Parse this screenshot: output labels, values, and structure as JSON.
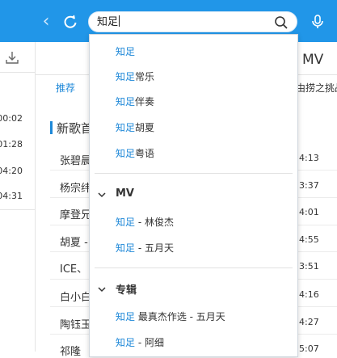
{
  "search": {
    "value": "知足"
  },
  "main": {
    "mv_header": "MV",
    "tab_recommend": "推荐",
    "challenge_text": "由捞之挑战",
    "section_title": "新歌首",
    "songs": [
      {
        "title": "张碧晨",
        "duration": "4:13"
      },
      {
        "title": "杨宗纬",
        "duration": "3:37"
      },
      {
        "title": "摩登兄",
        "duration": "4:01"
      },
      {
        "title": "胡夏 -",
        "duration": "4:55"
      },
      {
        "title": "ICE、",
        "duration": "3:51"
      },
      {
        "title": "白小白",
        "duration": "4:16"
      },
      {
        "title": "陶钰玉",
        "duration": "4:27"
      },
      {
        "title": "祁隆",
        "duration": "5:07"
      }
    ]
  },
  "left": {
    "times": [
      "00:02",
      "01:28",
      "04:20",
      "04:31"
    ]
  },
  "dropdown": {
    "suggestions": [
      {
        "hl": "知足",
        "rest": ""
      },
      {
        "hl": "知足",
        "rest": "常乐"
      },
      {
        "hl": "知足",
        "rest": "伴奏"
      },
      {
        "hl": "知足",
        "rest": "胡夏"
      },
      {
        "hl": "知足",
        "rest": "粤语"
      }
    ],
    "mv_label": "MV",
    "mv_items": [
      {
        "hl": "知足",
        "rest": " - 林俊杰"
      },
      {
        "hl": "知足",
        "rest": " - 五月天"
      }
    ],
    "album_label": "专辑",
    "album_items": [
      {
        "hl": "知足",
        "rest": " 最真杰作选 - 五月天"
      },
      {
        "hl": "知足",
        "rest": " - 阿细"
      }
    ]
  },
  "colors": {
    "accent": "#2196e8",
    "highlight": "#1e88d8"
  },
  "icons": [
    "back-arrow-icon",
    "refresh-icon",
    "search-icon",
    "microphone-icon",
    "download-icon",
    "chevron-down-icon"
  ]
}
